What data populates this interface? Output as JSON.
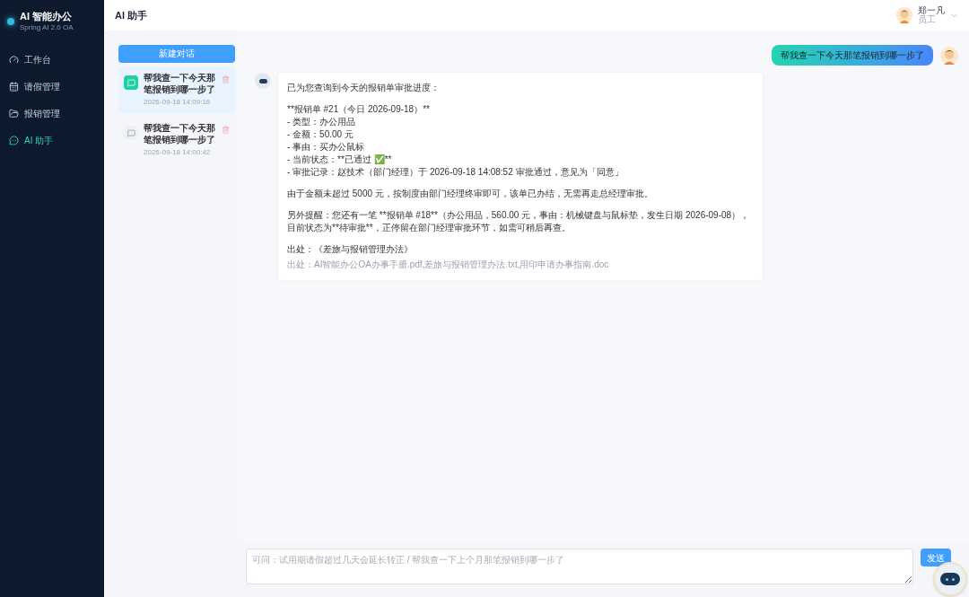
{
  "sidebar": {
    "title": "AI 智能办公",
    "subtitle": "Spring AI 2.0 OA",
    "items": [
      {
        "label": "工作台",
        "selected": false
      },
      {
        "label": "请假管理",
        "selected": false
      },
      {
        "label": "报销管理",
        "selected": false
      },
      {
        "label": "AI 助手",
        "selected": true
      }
    ]
  },
  "header": {
    "title": "AI 助手",
    "user": {
      "name": "郑一凡",
      "role": "员工"
    }
  },
  "conversations": {
    "new_button": "新建对话",
    "items": [
      {
        "title": "帮我查一下今天那笔报销到哪一步了",
        "time": "2026-09-18 14:09:16",
        "selected": true
      },
      {
        "title": "帮我查一下今天那笔报销到哪一步了",
        "time": "2026-09-18 14:00:42",
        "selected": false
      }
    ]
  },
  "messages": [
    {
      "kind": "user",
      "text": "帮我查一下今天那笔报销到哪一步了"
    },
    {
      "kind": "assistant",
      "paragraphs": [
        [
          "已为您查询到今天的报销单审批进度："
        ],
        [
          "**报销单 #21（今日 2026-09-18）**",
          "- 类型：办公用品",
          "- 金额：50.00 元",
          "- 事由：买办公鼠标",
          "- 当前状态：**已通过 ✅**",
          "- 审批记录：赵技术（部门经理）于 2026-09-18 14:08:52 审批通过，意见为「同意」"
        ],
        [
          "由于金额未超过 5000 元，按制度由部门经理终审即可，该单已办结，无需再走总经理审批。"
        ],
        [
          "另外提醒：您还有一笔 **报销单 #18**（办公用品，560.00 元，事由：机械键盘与鼠标垫，发生日期 2026-09-08），目前状态为**待审批**，正停留在部门经理审批环节，如需可稍后再查。"
        ],
        [
          "出处：《差旅与报销管理办法》"
        ]
      ],
      "source": "出处：AI智能办公OA办事手册.pdf,差旅与报销管理办法.txt,用印申请办事指南.doc"
    }
  ],
  "input": {
    "placeholder": "可问：试用期请假超过几天会延长转正 / 帮我查一下上个月那笔报销到哪一步了",
    "send_button": "发送"
  }
}
